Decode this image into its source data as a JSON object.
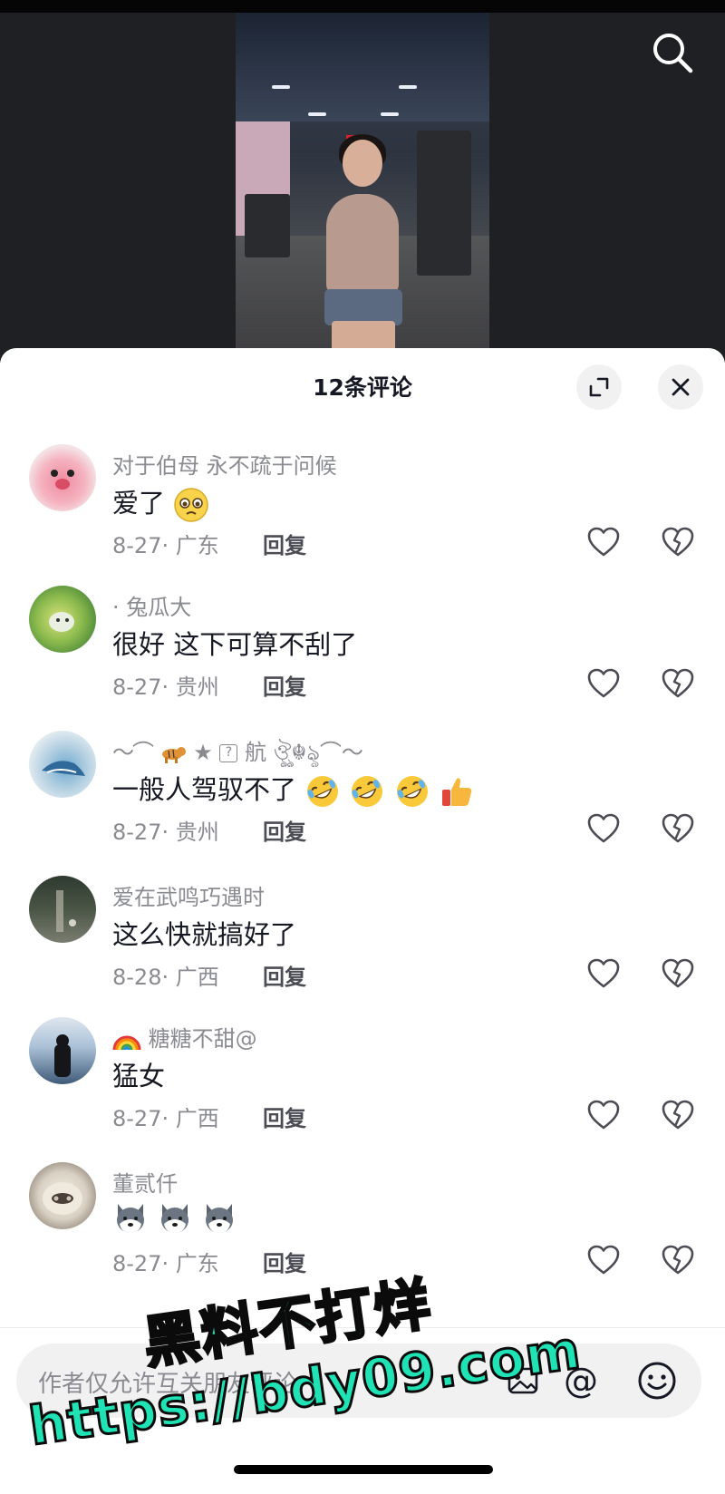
{
  "header": {
    "search_icon": "search-icon"
  },
  "sheet": {
    "title": "12条评论",
    "expand_icon": "expand-icon",
    "close_icon": "close-icon"
  },
  "comments": [
    {
      "name": "对于伯母 永不疏于问候",
      "text": "爱了",
      "emojis": [
        "pleading-face"
      ],
      "date": "8-27",
      "location": "广东",
      "reply_label": "回复"
    },
    {
      "name": "· 兔瓜大",
      "text": "很好 这下可算不刮了",
      "emojis": [],
      "date": "8-27",
      "location": "贵州",
      "reply_label": "回复"
    },
    {
      "name": "航",
      "text": "一般人驾驭不了",
      "emojis": [
        "rofl",
        "rofl",
        "rofl",
        "thumbs-up"
      ],
      "date": "8-27",
      "location": "贵州",
      "reply_label": "回复"
    },
    {
      "name": "爱在武鸣巧遇时",
      "text": "这么快就搞好了",
      "emojis": [],
      "date": "8-28",
      "location": "广西",
      "reply_label": "回复"
    },
    {
      "name": "糖糖不甜@",
      "text": "猛女",
      "emojis": [],
      "date": "8-27",
      "location": "广西",
      "reply_label": "回复"
    },
    {
      "name": "董贰仟",
      "text": "",
      "emojis": [
        "husky",
        "husky",
        "husky"
      ],
      "date": "8-27",
      "location": "广东",
      "reply_label": "回复"
    }
  ],
  "input": {
    "placeholder": "作者仅允许互关朋友评论",
    "at_label": "@",
    "emoji_icon": "emoji-icon",
    "image_icon": "image-icon"
  },
  "watermark": {
    "line1": "黑料不打烊",
    "line2": "https://bdy09.com"
  },
  "colors": {
    "video_bg": "#1f2024",
    "primary_text": "#161823",
    "secondary_text": "#8a8b91",
    "button_bg": "#f1f1f2",
    "watermark": "#1fe3b5"
  }
}
